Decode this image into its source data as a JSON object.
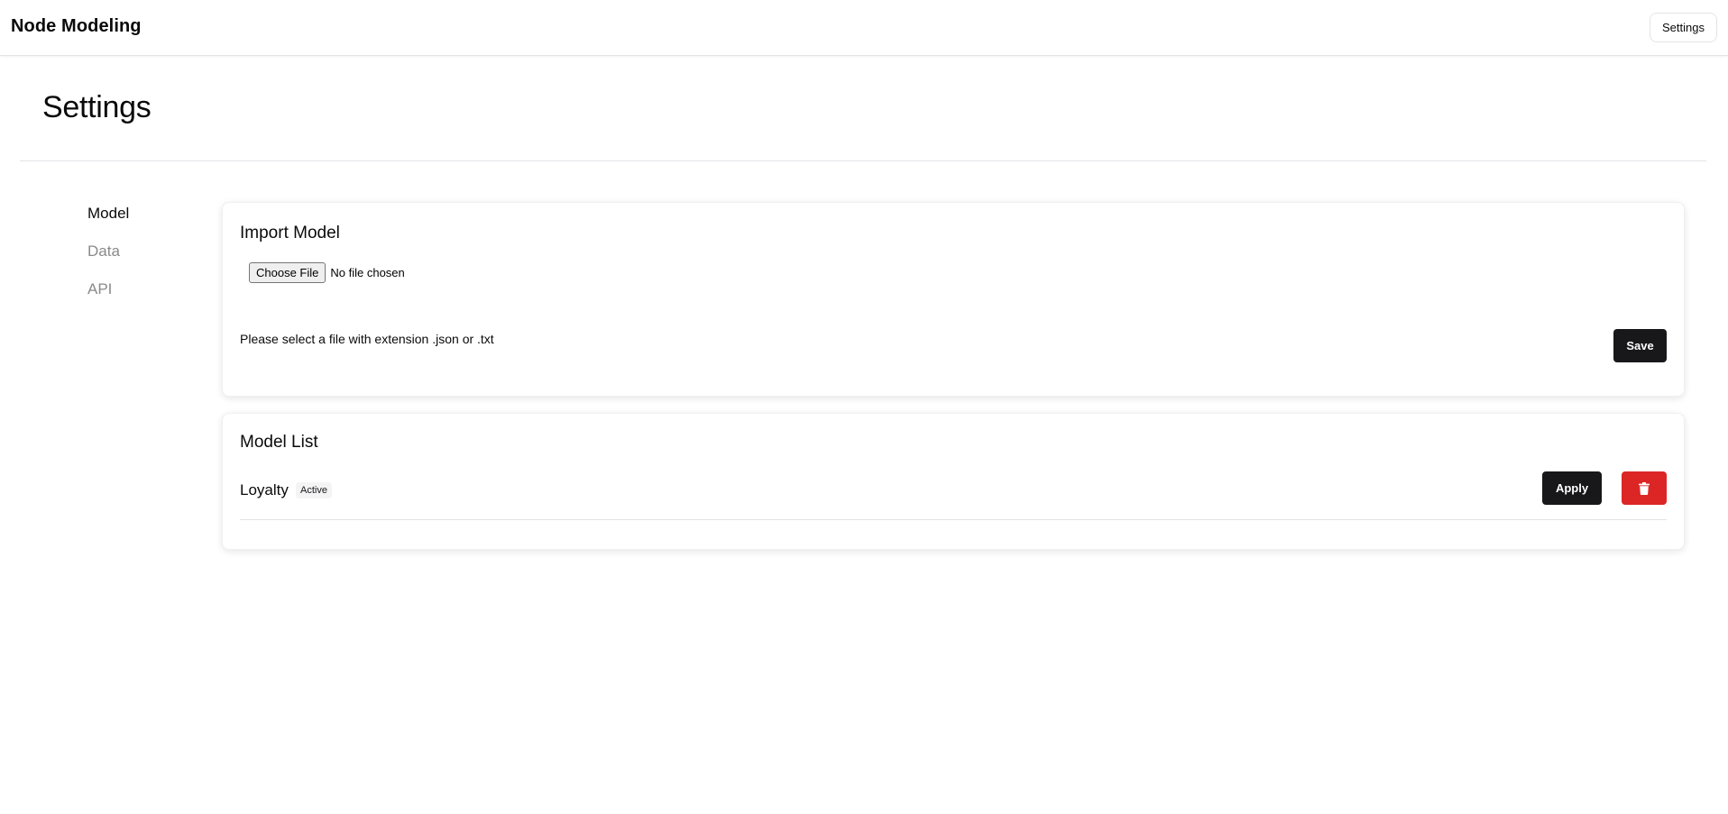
{
  "app": {
    "title": "Node Modeling",
    "settings_button": "Settings"
  },
  "page": {
    "title": "Settings"
  },
  "sidebar": {
    "items": [
      {
        "label": "Model",
        "active": true
      },
      {
        "label": "Data",
        "active": false
      },
      {
        "label": "API",
        "active": false
      }
    ]
  },
  "import_card": {
    "title": "Import Model",
    "choose_file_label": "Choose File",
    "file_status": "No file chosen",
    "hint": "Please select a file with extension .json or .txt",
    "save_label": "Save"
  },
  "model_list": {
    "title": "Model List",
    "models": [
      {
        "name": "Loyalty",
        "status": "Active",
        "apply_label": "Apply",
        "delete_icon": "trash-icon"
      }
    ]
  },
  "colors": {
    "primary_dark": "#18181b",
    "danger": "#dc2626",
    "muted_text": "#8a8a8a",
    "border": "#e4e4e7"
  }
}
